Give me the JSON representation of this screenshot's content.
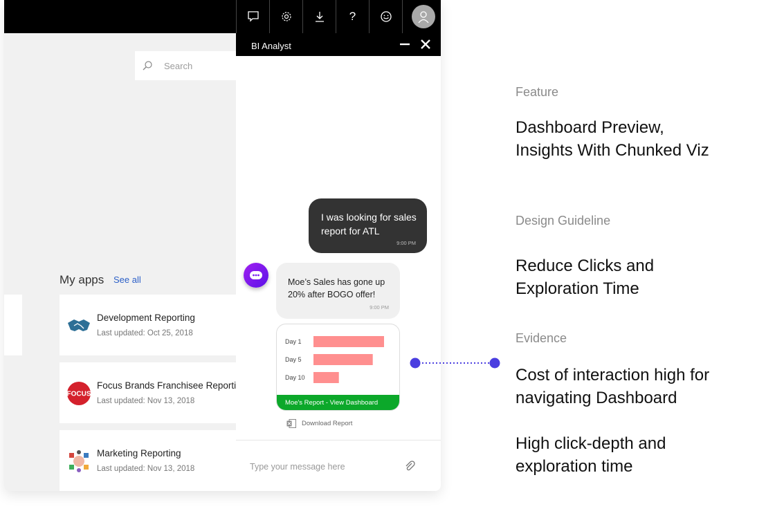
{
  "topbar": {
    "icons": [
      "chat-icon",
      "gear-icon",
      "download-icon",
      "help-icon",
      "smiley-icon",
      "avatar-icon"
    ],
    "help_glyph": "?"
  },
  "search": {
    "placeholder": "Search"
  },
  "my_apps": {
    "title": "My apps",
    "see_all": "See all",
    "cards": [
      {
        "title": "Development Reporting",
        "subtitle": "Last updated: Oct 25, 2018",
        "icon": "handshake-logo"
      },
      {
        "title": "Focus Brands Franchisee Reporting",
        "subtitle": "Last updated: Nov 13, 2018",
        "icon": "focus-logo",
        "logo_text": "FOCUS"
      },
      {
        "title": "Marketing Reporting",
        "subtitle": "Last updated: Nov 13, 2018",
        "icon": "marketing-logo"
      }
    ]
  },
  "chat": {
    "title": "BI Analyst",
    "user_message": {
      "text": "I was looking for sales report for ATL",
      "time": "9:00 PM"
    },
    "bot_message": {
      "text": "Moe’s Sales has gone up 20% after BOGO offer!",
      "time": "9:00 PM"
    },
    "report_link": "Moe's Report - View Dashboard",
    "download": "Download Report",
    "input_placeholder": "Type your message here"
  },
  "chart_data": {
    "type": "bar",
    "orientation": "horizontal",
    "categories": [
      "Day 1",
      "Day 5",
      "Day 10"
    ],
    "values": [
      100,
      84,
      36
    ],
    "bar_color": "#ff8f8f"
  },
  "annotations": {
    "feature_label": "Feature",
    "feature_heading": [
      "Dashboard Preview,",
      "Insights With Chunked Viz"
    ],
    "guideline_label": "Design Guideline",
    "guideline_heading": [
      "Reduce Clicks and",
      "Exploration Time"
    ],
    "evidence_label": "Evidence",
    "evidence_heading_1": [
      "Cost of interaction high for",
      "navigating Dashboard"
    ],
    "evidence_heading_2": [
      "High click-depth and",
      "exploration time"
    ]
  },
  "colors": {
    "accent": "#4a3ee0",
    "bot": "#8a1cf0",
    "link_bar": "#0ca82a",
    "user_bubble": "#333333"
  }
}
